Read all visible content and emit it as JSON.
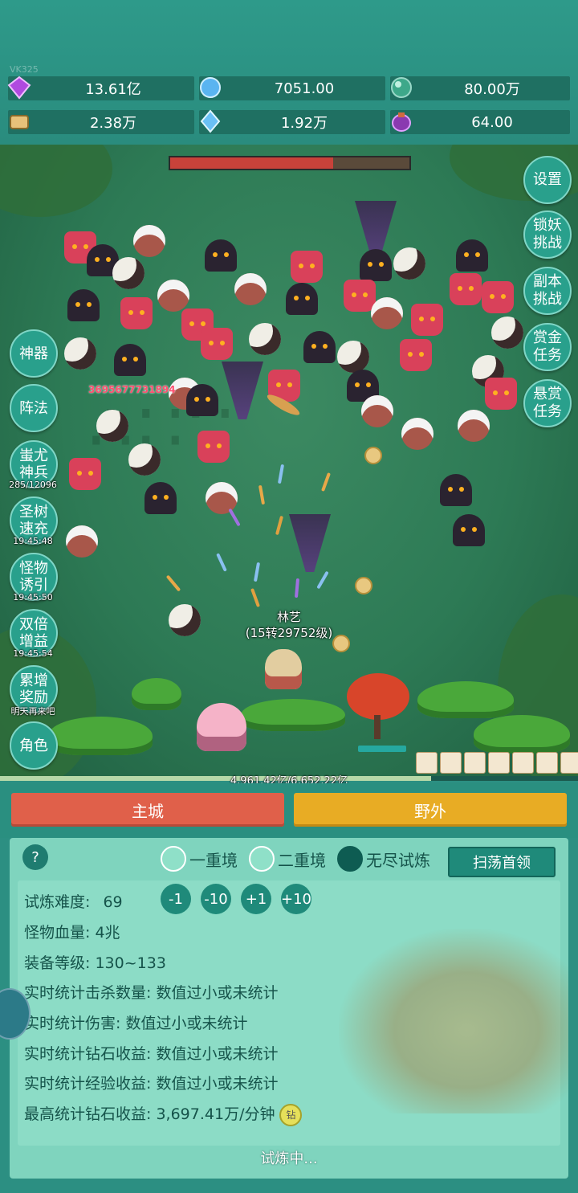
{
  "version": "VK325",
  "resources": [
    {
      "icon": "purple-diamond-icon",
      "value": "13.61亿"
    },
    {
      "icon": "blue-crystal-icon",
      "value": "7051.00"
    },
    {
      "icon": "teal-orb-icon",
      "value": "80.00万"
    },
    {
      "icon": "scroll-book-icon",
      "value": "2.38万"
    },
    {
      "icon": "ice-crystal-icon",
      "value": "1.92万"
    },
    {
      "icon": "purple-pouch-icon",
      "value": "64.00"
    }
  ],
  "boss_hp": 0.68,
  "right_buttons": [
    {
      "l1": "设置",
      "l2": ""
    },
    {
      "l1": "锁妖",
      "l2": "挑战"
    },
    {
      "l1": "副本",
      "l2": "挑战"
    },
    {
      "l1": "赏金",
      "l2": "任务"
    },
    {
      "l1": "悬赏",
      "l2": "任务"
    }
  ],
  "left_buttons": [
    {
      "l1": "神器",
      "l2": "",
      "sub": ""
    },
    {
      "l1": "阵法",
      "l2": "",
      "sub": ""
    },
    {
      "l1": "蚩尤",
      "l2": "神兵",
      "sub": "285/12096"
    },
    {
      "l1": "圣树",
      "l2": "速充",
      "sub": "19:45:48"
    },
    {
      "l1": "怪物",
      "l2": "诱引",
      "sub": "19:45:50"
    },
    {
      "l1": "双倍",
      "l2": "增益",
      "sub": "19:45:54"
    },
    {
      "l1": "累增",
      "l2": "奖励",
      "sub": "明天再来吧"
    },
    {
      "l1": "角色",
      "l2": "",
      "sub": ""
    }
  ],
  "damage_number": "3695677731894",
  "player": {
    "name": "林艺",
    "level": "(15转29752级)"
  },
  "exp": {
    "text": "4,961.42亿/6,652.22亿",
    "fraction": 0.746
  },
  "tabs": {
    "city": "主城",
    "wild": "野外"
  },
  "modes": {
    "help": "?",
    "option1": "一重境",
    "option2": "二重境",
    "option3": "无尽试炼",
    "selected": 3
  },
  "sweep_button": "扫荡首领",
  "difficulty": {
    "label": "试炼难度:",
    "value": "69",
    "steps": [
      "-1",
      "-10",
      "+1",
      "+10"
    ]
  },
  "stats": [
    {
      "label": "怪物血量:",
      "value": "4兆"
    },
    {
      "label": "装备等级:",
      "value": "130~133"
    },
    {
      "label": "实时统计击杀数量:",
      "value": "数值过小或未统计"
    },
    {
      "label": "实时统计伤害:",
      "value": "数值过小或未统计"
    },
    {
      "label": "实时统计钻石收益:",
      "value": "数值过小或未统计"
    },
    {
      "label": "实时统计经验收益:",
      "value": "数值过小或未统计"
    },
    {
      "label": "最高统计钻石收益:",
      "value": "3,697.41万/分钟"
    }
  ],
  "diamond_badge": "钻",
  "status": "试炼中..."
}
